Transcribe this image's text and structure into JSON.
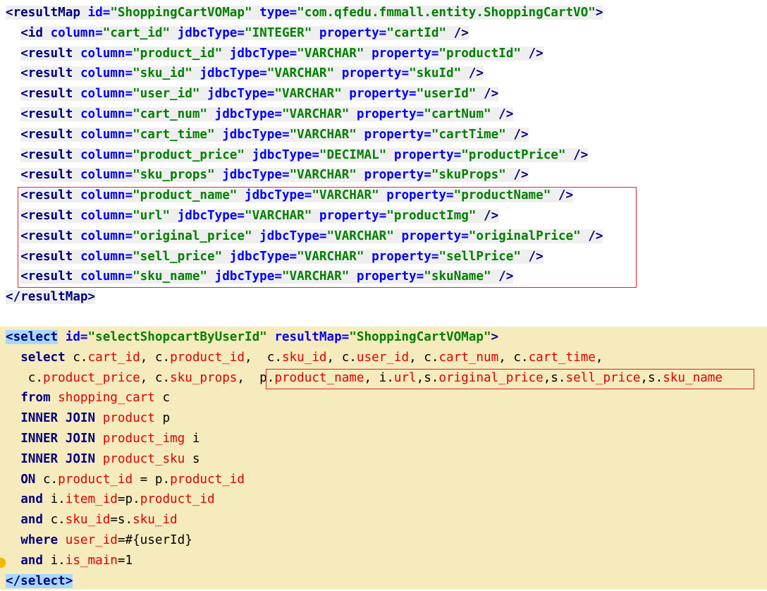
{
  "colors": {
    "tag": "#000080",
    "attr": "#0000ff",
    "value": "#008000",
    "sqlkw": "#000080",
    "sqlid": "#e00000",
    "plain": "#000000",
    "highlight_block": "#f6ebbd",
    "box": "#e0202a"
  },
  "code": {
    "result_map": [
      {
        "tokens": [
          {
            "t": "<resultMap ",
            "c": "tag"
          },
          {
            "t": "id=",
            "c": "attr"
          },
          {
            "t": "\"ShoppingCartVOMap\"",
            "c": "value"
          },
          {
            "t": " type=",
            "c": "attr"
          },
          {
            "t": "\"com.qfedu.fmmall.entity.ShoppingCartVO\"",
            "c": "value"
          },
          {
            "t": ">",
            "c": "tag"
          }
        ]
      },
      {
        "indent": "  ",
        "tokens": [
          {
            "t": "<id ",
            "c": "tag"
          },
          {
            "t": "column=",
            "c": "attr"
          },
          {
            "t": "\"cart_id\"",
            "c": "value"
          },
          {
            "t": " jdbcType=",
            "c": "attr"
          },
          {
            "t": "\"INTEGER\"",
            "c": "value"
          },
          {
            "t": " property=",
            "c": "attr"
          },
          {
            "t": "\"cartId\"",
            "c": "value"
          },
          {
            "t": " />",
            "c": "tag"
          }
        ]
      },
      {
        "indent": "  ",
        "tokens": [
          {
            "t": "<result ",
            "c": "tag"
          },
          {
            "t": "column=",
            "c": "attr"
          },
          {
            "t": "\"product_id\"",
            "c": "value"
          },
          {
            "t": " jdbcType=",
            "c": "attr"
          },
          {
            "t": "\"VARCHAR\"",
            "c": "value"
          },
          {
            "t": " property=",
            "c": "attr"
          },
          {
            "t": "\"productId\"",
            "c": "value"
          },
          {
            "t": " />",
            "c": "tag"
          }
        ]
      },
      {
        "indent": "  ",
        "tokens": [
          {
            "t": "<result ",
            "c": "tag"
          },
          {
            "t": "column=",
            "c": "attr"
          },
          {
            "t": "\"sku_id\"",
            "c": "value"
          },
          {
            "t": " jdbcType=",
            "c": "attr"
          },
          {
            "t": "\"VARCHAR\"",
            "c": "value"
          },
          {
            "t": " property=",
            "c": "attr"
          },
          {
            "t": "\"skuId\"",
            "c": "value"
          },
          {
            "t": " />",
            "c": "tag"
          }
        ]
      },
      {
        "indent": "  ",
        "tokens": [
          {
            "t": "<result ",
            "c": "tag"
          },
          {
            "t": "column=",
            "c": "attr"
          },
          {
            "t": "\"user_id\"",
            "c": "value"
          },
          {
            "t": " jdbcType=",
            "c": "attr"
          },
          {
            "t": "\"VARCHAR\"",
            "c": "value"
          },
          {
            "t": " property=",
            "c": "attr"
          },
          {
            "t": "\"userId\"",
            "c": "value"
          },
          {
            "t": " />",
            "c": "tag"
          }
        ]
      },
      {
        "indent": "  ",
        "tokens": [
          {
            "t": "<result ",
            "c": "tag"
          },
          {
            "t": "column=",
            "c": "attr"
          },
          {
            "t": "\"cart_num\"",
            "c": "value"
          },
          {
            "t": " jdbcType=",
            "c": "attr"
          },
          {
            "t": "\"VARCHAR\"",
            "c": "value"
          },
          {
            "t": " property=",
            "c": "attr"
          },
          {
            "t": "\"cartNum\"",
            "c": "value"
          },
          {
            "t": " />",
            "c": "tag"
          }
        ]
      },
      {
        "indent": "  ",
        "tokens": [
          {
            "t": "<result ",
            "c": "tag"
          },
          {
            "t": "column=",
            "c": "attr"
          },
          {
            "t": "\"cart_time\"",
            "c": "value"
          },
          {
            "t": " jdbcType=",
            "c": "attr"
          },
          {
            "t": "\"VARCHAR\"",
            "c": "value"
          },
          {
            "t": " property=",
            "c": "attr"
          },
          {
            "t": "\"cartTime\"",
            "c": "value"
          },
          {
            "t": " />",
            "c": "tag"
          }
        ]
      },
      {
        "indent": "  ",
        "tokens": [
          {
            "t": "<result ",
            "c": "tag"
          },
          {
            "t": "column=",
            "c": "attr"
          },
          {
            "t": "\"product_price\"",
            "c": "value"
          },
          {
            "t": " jdbcType=",
            "c": "attr"
          },
          {
            "t": "\"DECIMAL\"",
            "c": "value"
          },
          {
            "t": " property=",
            "c": "attr"
          },
          {
            "t": "\"productPrice\"",
            "c": "value"
          },
          {
            "t": " />",
            "c": "tag"
          }
        ]
      },
      {
        "indent": "  ",
        "tokens": [
          {
            "t": "<result ",
            "c": "tag"
          },
          {
            "t": "column=",
            "c": "attr"
          },
          {
            "t": "\"sku_props\"",
            "c": "value"
          },
          {
            "t": " jdbcType=",
            "c": "attr"
          },
          {
            "t": "\"VARCHAR\"",
            "c": "value"
          },
          {
            "t": " property=",
            "c": "attr"
          },
          {
            "t": "\"skuProps\"",
            "c": "value"
          },
          {
            "t": " />",
            "c": "tag"
          }
        ]
      },
      {
        "indent": "  ",
        "tokens": [
          {
            "t": "<result ",
            "c": "tag"
          },
          {
            "t": "column=",
            "c": "attr"
          },
          {
            "t": "\"product_name\"",
            "c": "value"
          },
          {
            "t": " jdbcType=",
            "c": "attr"
          },
          {
            "t": "\"VARCHAR\"",
            "c": "value"
          },
          {
            "t": " property=",
            "c": "attr"
          },
          {
            "t": "\"productName\"",
            "c": "value"
          },
          {
            "t": " />",
            "c": "tag"
          }
        ]
      },
      {
        "indent": "  ",
        "tokens": [
          {
            "t": "<result ",
            "c": "tag"
          },
          {
            "t": "column=",
            "c": "attr"
          },
          {
            "t": "\"url\"",
            "c": "value"
          },
          {
            "t": " jdbcType=",
            "c": "attr"
          },
          {
            "t": "\"VARCHAR\"",
            "c": "value"
          },
          {
            "t": " property=",
            "c": "attr"
          },
          {
            "t": "\"productImg\"",
            "c": "value"
          },
          {
            "t": " />",
            "c": "tag"
          }
        ]
      },
      {
        "indent": "  ",
        "tokens": [
          {
            "t": "<result ",
            "c": "tag"
          },
          {
            "t": "column=",
            "c": "attr"
          },
          {
            "t": "\"original_price\"",
            "c": "value"
          },
          {
            "t": " jdbcType=",
            "c": "attr"
          },
          {
            "t": "\"VARCHAR\"",
            "c": "value"
          },
          {
            "t": " property=",
            "c": "attr"
          },
          {
            "t": "\"originalPrice\"",
            "c": "value"
          },
          {
            "t": " />",
            "c": "tag"
          }
        ]
      },
      {
        "indent": "  ",
        "tokens": [
          {
            "t": "<result ",
            "c": "tag"
          },
          {
            "t": "column=",
            "c": "attr"
          },
          {
            "t": "\"sell_price\"",
            "c": "value"
          },
          {
            "t": " jdbcType=",
            "c": "attr"
          },
          {
            "t": "\"VARCHAR\"",
            "c": "value"
          },
          {
            "t": " property=",
            "c": "attr"
          },
          {
            "t": "\"sellPrice\"",
            "c": "value"
          },
          {
            "t": " />",
            "c": "tag"
          }
        ]
      },
      {
        "indent": "  ",
        "tokens": [
          {
            "t": "<result ",
            "c": "tag"
          },
          {
            "t": "column=",
            "c": "attr"
          },
          {
            "t": "\"sku_name\"",
            "c": "value"
          },
          {
            "t": " jdbcType=",
            "c": "attr"
          },
          {
            "t": "\"VARCHAR\"",
            "c": "value"
          },
          {
            "t": " property=",
            "c": "attr"
          },
          {
            "t": "\"skuName\"",
            "c": "value"
          },
          {
            "t": " />",
            "c": "tag"
          }
        ]
      },
      {
        "tokens": [
          {
            "t": "</resultMap>",
            "c": "tag"
          }
        ]
      }
    ],
    "select": [
      {
        "tokens": [
          {
            "t": "<select",
            "c": "tag",
            "match": true
          },
          {
            "t": " id=",
            "c": "attr"
          },
          {
            "t": "\"selectShopcartByUserId\"",
            "c": "value"
          },
          {
            "t": " resultMap=",
            "c": "attr"
          },
          {
            "t": "\"ShoppingCartVOMap\"",
            "c": "value"
          },
          {
            "t": ">",
            "c": "tag"
          }
        ]
      },
      {
        "indent": "  ",
        "tokens": [
          {
            "t": "select ",
            "c": "sqlkw"
          },
          {
            "t": "c.",
            "c": "plain"
          },
          {
            "t": "cart_id",
            "c": "sqlid"
          },
          {
            "t": ", c.",
            "c": "plain"
          },
          {
            "t": "product_id",
            "c": "sqlid"
          },
          {
            "t": ",  c.",
            "c": "plain"
          },
          {
            "t": "sku_id",
            "c": "sqlid"
          },
          {
            "t": ", c.",
            "c": "plain"
          },
          {
            "t": "user_id",
            "c": "sqlid"
          },
          {
            "t": ", c.",
            "c": "plain"
          },
          {
            "t": "cart_num",
            "c": "sqlid"
          },
          {
            "t": ", c.",
            "c": "plain"
          },
          {
            "t": "cart_time",
            "c": "sqlid"
          },
          {
            "t": ",",
            "c": "plain"
          }
        ]
      },
      {
        "indent": "   ",
        "tokens": [
          {
            "t": "c.",
            "c": "plain"
          },
          {
            "t": "product_price",
            "c": "sqlid"
          },
          {
            "t": ", c.",
            "c": "plain"
          },
          {
            "t": "sku_props",
            "c": "sqlid"
          },
          {
            "t": ",  ",
            "c": "plain"
          },
          {
            "t": "p.",
            "c": "plain"
          },
          {
            "t": "product_name",
            "c": "sqlid"
          },
          {
            "t": ", i.",
            "c": "plain"
          },
          {
            "t": "url",
            "c": "sqlid"
          },
          {
            "t": ",s.",
            "c": "plain"
          },
          {
            "t": "original_price",
            "c": "sqlid"
          },
          {
            "t": ",s.",
            "c": "plain"
          },
          {
            "t": "sell_price",
            "c": "sqlid"
          },
          {
            "t": ",s.",
            "c": "plain"
          },
          {
            "t": "sku_name",
            "c": "sqlid"
          }
        ]
      },
      {
        "indent": "  ",
        "tokens": [
          {
            "t": "from ",
            "c": "sqlkw"
          },
          {
            "t": "shopping_cart",
            "c": "sqlid"
          },
          {
            "t": " c",
            "c": "plain"
          }
        ]
      },
      {
        "indent": "  ",
        "tokens": [
          {
            "t": "INNER JOIN ",
            "c": "sqlkw"
          },
          {
            "t": "product",
            "c": "sqlid"
          },
          {
            "t": " p",
            "c": "plain"
          }
        ]
      },
      {
        "indent": "  ",
        "tokens": [
          {
            "t": "INNER JOIN ",
            "c": "sqlkw"
          },
          {
            "t": "product_img",
            "c": "sqlid"
          },
          {
            "t": " i",
            "c": "plain"
          }
        ]
      },
      {
        "indent": "  ",
        "tokens": [
          {
            "t": "INNER JOIN ",
            "c": "sqlkw"
          },
          {
            "t": "product_sku",
            "c": "sqlid"
          },
          {
            "t": " s",
            "c": "plain"
          }
        ]
      },
      {
        "indent": "  ",
        "tokens": [
          {
            "t": "ON ",
            "c": "sqlkw"
          },
          {
            "t": "c.",
            "c": "plain"
          },
          {
            "t": "product_id",
            "c": "sqlid"
          },
          {
            "t": " = p.",
            "c": "plain"
          },
          {
            "t": "product_id",
            "c": "sqlid"
          }
        ]
      },
      {
        "indent": "  ",
        "tokens": [
          {
            "t": "and ",
            "c": "sqlkw"
          },
          {
            "t": "i.",
            "c": "plain"
          },
          {
            "t": "item_id",
            "c": "sqlid"
          },
          {
            "t": "=p.",
            "c": "plain"
          },
          {
            "t": "product_id",
            "c": "sqlid"
          }
        ]
      },
      {
        "indent": "  ",
        "tokens": [
          {
            "t": "and ",
            "c": "sqlkw"
          },
          {
            "t": "c.",
            "c": "plain"
          },
          {
            "t": "sku_id",
            "c": "sqlid"
          },
          {
            "t": "=s.",
            "c": "plain"
          },
          {
            "t": "sku_id",
            "c": "sqlid"
          }
        ]
      },
      {
        "indent": "  ",
        "tokens": [
          {
            "t": "where ",
            "c": "sqlkw"
          },
          {
            "t": "user_id",
            "c": "sqlid"
          },
          {
            "t": "=#{userId}",
            "c": "plain"
          }
        ]
      },
      {
        "indent": "  ",
        "tokens": [
          {
            "t": "and ",
            "c": "sqlkw"
          },
          {
            "t": "i.",
            "c": "plain"
          },
          {
            "t": "is_main",
            "c": "sqlid"
          },
          {
            "t": "=1",
            "c": "plain"
          }
        ]
      },
      {
        "tokens": [
          {
            "t": "</select>",
            "c": "tag",
            "match": true
          }
        ]
      }
    ]
  }
}
